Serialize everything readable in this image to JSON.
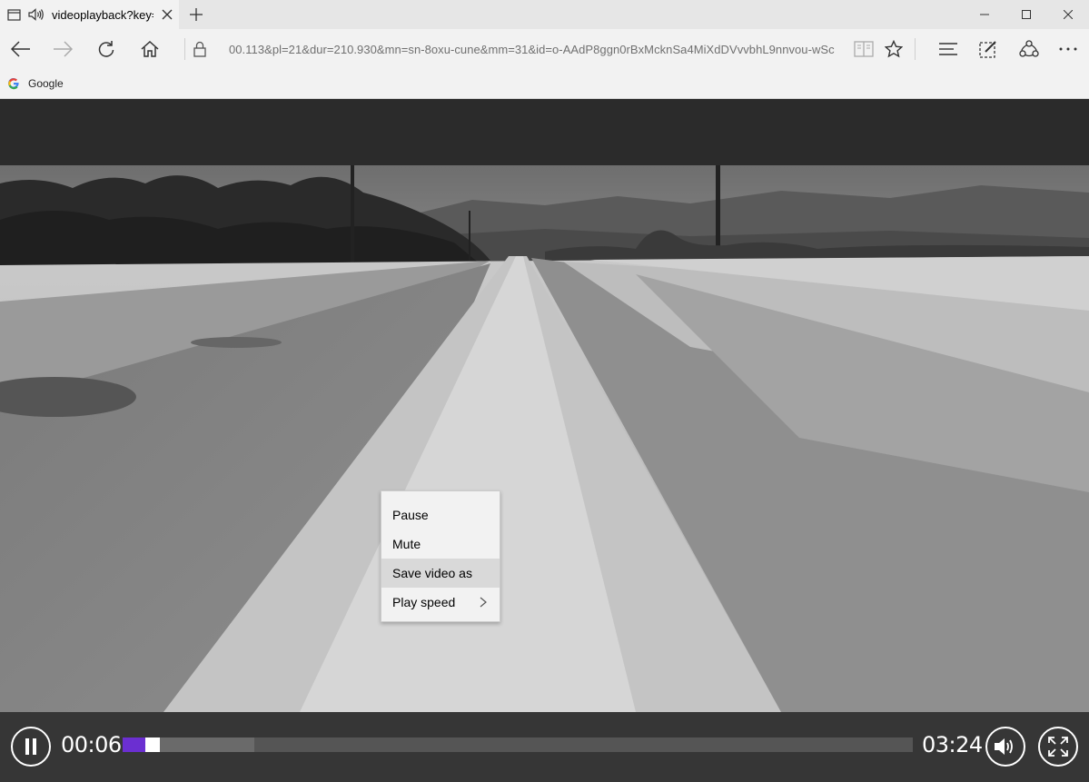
{
  "tab": {
    "title": "videoplayback?key=",
    "icons": [
      "page-icon",
      "audio-playing-icon",
      "close-icon"
    ]
  },
  "window_controls": [
    "minimize-icon",
    "maximize-icon",
    "close-icon"
  ],
  "nav": {
    "url": "00.113&pl=21&dur=210.930&mn=sn-8oxu-cune&mm=31&id=o-AAdP8ggn0rBxMcknSa4MiXdDVvvbhL9nnvou-wSc"
  },
  "favorites": [
    {
      "label": "Google",
      "icon": "google-g-icon"
    }
  ],
  "context_menu": {
    "items": [
      {
        "label": "Pause"
      },
      {
        "label": "Mute"
      },
      {
        "label": "Save video as",
        "highlighted": true
      },
      {
        "label": "Play speed",
        "submenu": true
      }
    ]
  },
  "player": {
    "current_time": "00:06",
    "duration": "03:24",
    "progress": 0.029,
    "buffered": 0.167,
    "colors": {
      "played": "#6b2fd1",
      "controls_bg": "#363636"
    }
  }
}
